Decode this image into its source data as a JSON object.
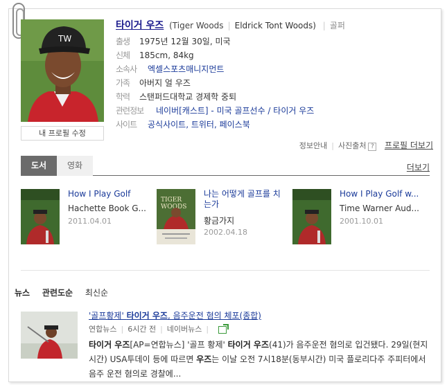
{
  "profile": {
    "name": "타이거 우즈",
    "name_en": "(Tiger Woods",
    "name_alias": "Eldrick Tont Woods)",
    "job": "골퍼",
    "edit_label": "내 프로필 수정",
    "rows": [
      {
        "key": "출생",
        "value": "1975년 12월 30일, 미국",
        "link": false
      },
      {
        "key": "신체",
        "value": "185cm, 84kg",
        "link": false
      },
      {
        "key": "소속사",
        "value": "엑셀스포츠매니지먼트",
        "link": true
      },
      {
        "key": "가족",
        "value": "아버지 얼 우즈",
        "link": false
      },
      {
        "key": "학력",
        "value": "스탠퍼드대학교 경제학 중퇴",
        "link": false
      },
      {
        "key": "관련정보",
        "value": "네이버[캐스트] - 미국 골프선수 / 타이거 우즈",
        "link": true
      },
      {
        "key": "사이트",
        "value": "공식사이트, 트위터, 페이스북",
        "link": true
      }
    ],
    "footer": {
      "info_guide": "정보안내",
      "photo_source": "사진출처",
      "help": "?",
      "more": "프로필 더보기"
    }
  },
  "media_tabs": {
    "active": "도서",
    "inactive": "영화",
    "more": "더보기"
  },
  "books": [
    {
      "title": "How I Play Golf",
      "publisher": "Hachette Book G...",
      "date": "2011.04.01"
    },
    {
      "title": "나는 어떻게 골프를 치는가",
      "publisher": "황금가지",
      "date": "2002.04.18"
    },
    {
      "title": "How I Play Golf w...",
      "publisher": "Time Warner Aud...",
      "date": "2001.10.01"
    }
  ],
  "news_tabs": {
    "news": "뉴스",
    "relevance": "관련도순",
    "latest": "최신순"
  },
  "news": {
    "title_pre": "'골프황제' ",
    "title_bold": "타이거 우즈",
    "title_post": ", 음주운전 혐의 체포(종합)",
    "source": "연합뉴스",
    "time": "6시간 전",
    "portal": "네이버뉴스",
    "body_b1": "타이거 우즈",
    "body_t1": "[AP=연합뉴스] '골프 황제' ",
    "body_b2": "타이거 우즈",
    "body_t2": "(41)가 음주운전 혐의로 입건됐다. 29일(현지시간) USA투데이 등에 따르면 ",
    "body_b3": "우즈",
    "body_t3": "는 이날 오전 7시18분(동부시간) 미국 플로리다주 주피터에서 음주 운전 혐의로 경찰에..."
  },
  "colors": {
    "link": "#1a3a99",
    "name": "#1a1a8c",
    "tab_active": "#6b6b6b",
    "share_icon": "#3a9a3a"
  }
}
